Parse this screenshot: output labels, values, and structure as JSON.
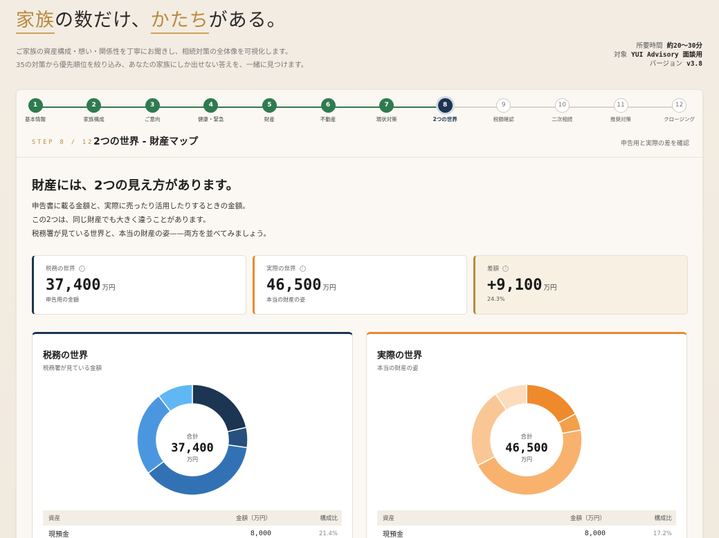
{
  "hero": {
    "title_part1": "家族",
    "title_part2": "の数だけ、",
    "title_part3": "かたち",
    "title_part4": "がある。",
    "sub_line1": "ご家族の資産構成・想い・関係性を丁寧にお聞きし、相続対策の全体像を可視化します。",
    "sub_line2": "35の対策から優先順位を絞り込み、あなたの家族にしか出せない答えを、一緒に見つけます。"
  },
  "meta": {
    "time_label": "所要時間",
    "time_value": "約20〜30分",
    "target_label": "対象",
    "target_value": "YUI Advisory 面談用",
    "version_label": "バージョン",
    "version_value": "v3.8"
  },
  "stepper": {
    "steps": [
      {
        "num": "1",
        "label": "基本情報"
      },
      {
        "num": "2",
        "label": "家族構成"
      },
      {
        "num": "3",
        "label": "ご意向"
      },
      {
        "num": "4",
        "label": "健康・緊急"
      },
      {
        "num": "5",
        "label": "財産"
      },
      {
        "num": "6",
        "label": "不動産"
      },
      {
        "num": "7",
        "label": "現状対策"
      },
      {
        "num": "8",
        "label": "2つの世界"
      },
      {
        "num": "9",
        "label": "税額確認"
      },
      {
        "num": "10",
        "label": "二次相続"
      },
      {
        "num": "11",
        "label": "推奨対策"
      },
      {
        "num": "12",
        "label": "クロージング"
      }
    ],
    "current_index": 8
  },
  "step_header": {
    "step_no": "STEP 8 / 12",
    "title": "2つの世界 - 財産マップ",
    "hint": "申告用と実際の差を確認"
  },
  "intro": {
    "title": "財産には、2つの見え方があります。",
    "line1": "申告書に載る金額と、実際に売ったり活用したりするときの金額。",
    "line2": "この2つは、同じ財産でも大きく違うことがあります。",
    "line3": "税務署が見ている世界と、本当の財産の姿——両方を並べてみましょう。"
  },
  "summary": {
    "tax": {
      "label": "税務の世界",
      "value": "37,400",
      "unit": "万円",
      "note": "申告用の金額"
    },
    "real": {
      "label": "実際の世界",
      "value": "46,500",
      "unit": "万円",
      "note": "本当の財産の姿"
    },
    "diff": {
      "label": "差額",
      "value": "+9,100",
      "unit": "万円",
      "note": "24.3%"
    },
    "info_glyph": "i"
  },
  "tax_world": {
    "title": "税務の世界",
    "subtitle": "税務署が見ている金額",
    "center_label": "合計",
    "center_value": "37,400",
    "center_unit": "万円",
    "table": {
      "headers": [
        "資産",
        "金額（万円）",
        "構成比"
      ],
      "rows": [
        [
          "現預金",
          "8,000",
          "21.4%"
        ]
      ]
    }
  },
  "real_world": {
    "title": "実際の世界",
    "subtitle": "本当の財産の姿",
    "center_label": "合計",
    "center_value": "46,500",
    "center_unit": "万円",
    "table": {
      "headers": [
        "資産",
        "金額（万円）",
        "構成比"
      ],
      "rows": [
        [
          "現預金",
          "8,000",
          "17.2%"
        ]
      ]
    }
  },
  "chart_data": [
    {
      "type": "pie",
      "title": "税務の世界",
      "total": 37400,
      "values": [
        8000,
        2200,
        14000,
        9300,
        3900
      ],
      "colors": [
        "#1b3553",
        "#27507e",
        "#3272b4",
        "#4b97df",
        "#5fb7f4"
      ]
    },
    {
      "type": "pie",
      "title": "実際の世界",
      "total": 46500,
      "values": [
        8000,
        2300,
        21000,
        10800,
        4400
      ],
      "colors": [
        "#ef8a2c",
        "#f3a04b",
        "#f8b26e",
        "#f9c795",
        "#fcdcbc"
      ]
    }
  ]
}
